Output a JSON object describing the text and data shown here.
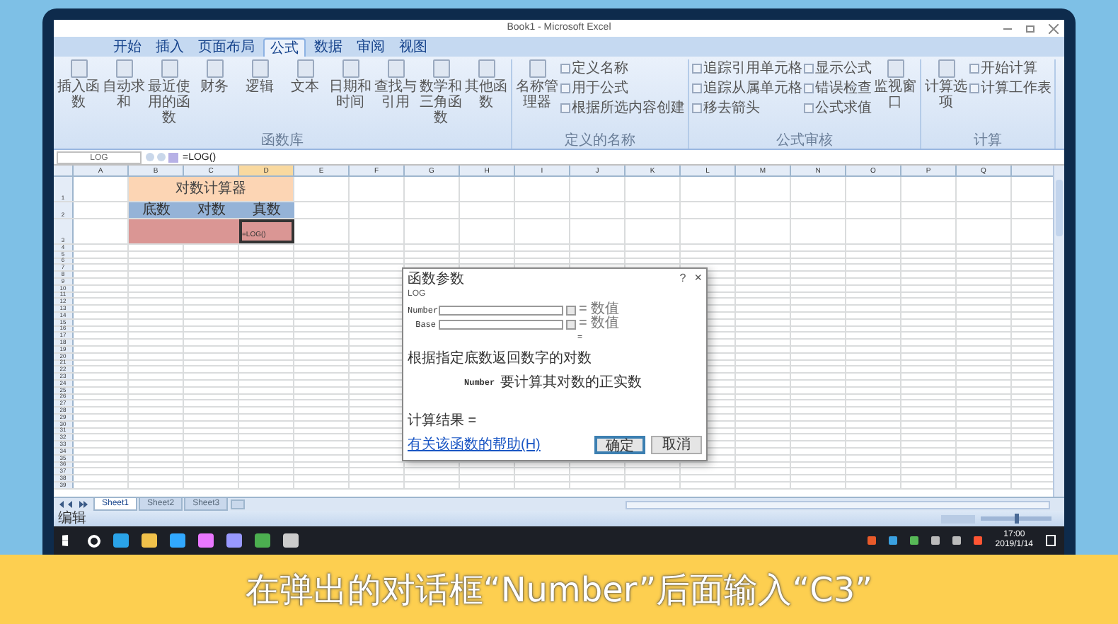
{
  "window": {
    "title": "Book1 - Microsoft Excel"
  },
  "ribbon": {
    "tabs": [
      {
        "label": "开始",
        "selected": false
      },
      {
        "label": "插入",
        "selected": false
      },
      {
        "label": "页面布局",
        "selected": false
      },
      {
        "label": "公式",
        "selected": true
      },
      {
        "label": "数据",
        "selected": false
      },
      {
        "label": "审阅",
        "selected": false
      },
      {
        "label": "视图",
        "selected": false
      }
    ],
    "groups": [
      {
        "label": "函数库",
        "columns": [
          [
            {
              "kind": "large",
              "label": "插入函数"
            }
          ],
          [
            {
              "kind": "large",
              "label": "自动求和"
            }
          ],
          [
            {
              "kind": "large",
              "label": "最近使用的函数"
            }
          ],
          [
            {
              "kind": "large",
              "label": "财务"
            }
          ],
          [
            {
              "kind": "large",
              "label": "逻辑"
            }
          ],
          [
            {
              "kind": "large",
              "label": "文本"
            }
          ],
          [
            {
              "kind": "large",
              "label": "日期和时间"
            }
          ],
          [
            {
              "kind": "large",
              "label": "查找与引用"
            }
          ],
          [
            {
              "kind": "large",
              "label": "数学和三角函数"
            }
          ],
          [
            {
              "kind": "large",
              "label": "其他函数"
            }
          ]
        ]
      },
      {
        "label": "定义的名称",
        "columns": [
          [
            {
              "kind": "large",
              "label": "名称管理器"
            }
          ],
          [
            {
              "kind": "small",
              "label": "定义名称"
            },
            {
              "kind": "small",
              "label": "用于公式"
            },
            {
              "kind": "small",
              "label": "根据所选内容创建"
            }
          ]
        ]
      },
      {
        "label": "公式审核",
        "columns": [
          [
            {
              "kind": "small",
              "label": "追踪引用单元格"
            },
            {
              "kind": "small",
              "label": "追踪从属单元格"
            },
            {
              "kind": "small",
              "label": "移去箭头"
            }
          ],
          [
            {
              "kind": "small",
              "label": "显示公式"
            },
            {
              "kind": "small",
              "label": "错误检查"
            },
            {
              "kind": "small",
              "label": "公式求值"
            }
          ],
          [
            {
              "kind": "large",
              "label": "监视窗口"
            }
          ]
        ]
      },
      {
        "label": "计算",
        "columns": [
          [
            {
              "kind": "large",
              "label": "计算选项"
            }
          ],
          [
            {
              "kind": "small",
              "label": "开始计算"
            },
            {
              "kind": "small",
              "label": "计算工作表"
            }
          ]
        ]
      }
    ]
  },
  "formula_bar": {
    "name_box": "LOG",
    "formula": "=LOG()"
  },
  "sheet": {
    "columns": [
      "A",
      "B",
      "C",
      "D",
      "E",
      "F",
      "G",
      "H",
      "I",
      "J",
      "K",
      "L",
      "M",
      "N",
      "O",
      "P",
      "Q"
    ],
    "row_numbers": [
      "1",
      "2",
      "3",
      "4",
      "5",
      "6",
      "7",
      "8",
      "9",
      "10",
      "11",
      "12",
      "13",
      "14",
      "15",
      "16",
      "17",
      "18",
      "19",
      "20",
      "21",
      "22",
      "23",
      "24",
      "25",
      "26",
      "27",
      "28",
      "29",
      "30",
      "31",
      "32",
      "33",
      "34",
      "35",
      "36",
      "37",
      "38",
      "39"
    ],
    "title_cell": "对数计算器",
    "header_cells": [
      "底数",
      "对数",
      "真数"
    ],
    "input_cells": [
      "",
      "",
      "=LOG()"
    ]
  },
  "dialog": {
    "title": "函数参数",
    "help_glyph": "?",
    "close_glyph": "×",
    "function_name": "LOG",
    "arguments": [
      {
        "name": "Number",
        "result": "= 数值"
      },
      {
        "name": "Base",
        "result": "= 数值"
      }
    ],
    "equals": "=",
    "description": "根据指定底数返回数字的对数",
    "arg_name": "Number",
    "arg_help": "要计算其对数的正实数",
    "result_label": "计算结果 =",
    "help_link": "有关该函数的帮助(H)",
    "buttons": [
      {
        "label": "确定",
        "default": true
      },
      {
        "label": "取消",
        "default": false
      }
    ]
  },
  "sheet_tabs": [
    {
      "label": "Sheet1",
      "selected": true
    },
    {
      "label": "Sheet2",
      "selected": false
    },
    {
      "label": "Sheet3",
      "selected": false
    }
  ],
  "status_bar": {
    "text": "编辑",
    "zoom_slider": {
      "level": 0.5
    }
  },
  "taskbar": {
    "time": "17:00",
    "date": "2019/1/14"
  },
  "caption": "在弹出的对话框“Number”后面输入“C3”"
}
